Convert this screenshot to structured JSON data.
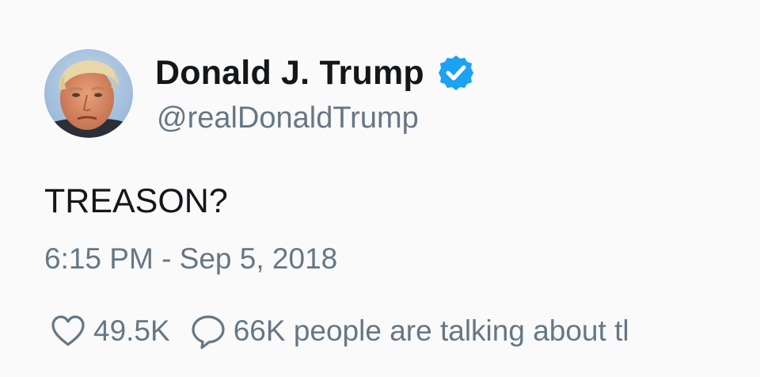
{
  "tweet": {
    "display_name": "Donald J. Trump",
    "handle": "@realDonaldTrump",
    "text": "TREASON?",
    "timestamp": "6:15 PM - Sep 5, 2018",
    "likes": "49.5K",
    "talking": "66K people are talking about tl",
    "icons": {
      "avatar": "profile-photo",
      "verified": "verified-badge-icon",
      "like": "heart-icon",
      "comment": "speech-bubble-icon"
    },
    "colors": {
      "name": "#14171a",
      "secondary": "#657786",
      "verified": "#1da1f2",
      "background": "#fafafa"
    }
  }
}
